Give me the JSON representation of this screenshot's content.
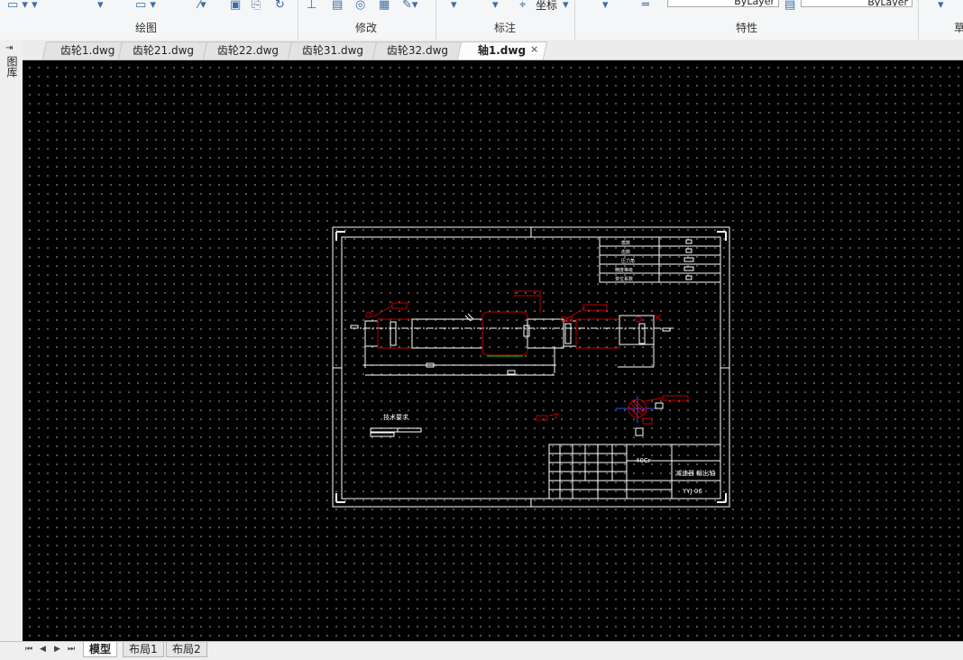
{
  "ribbon": {
    "groups": [
      {
        "label": "绘图"
      },
      {
        "label": "修改"
      },
      {
        "label": "标注"
      },
      {
        "label": "特性"
      },
      {
        "label": "草"
      }
    ],
    "coord_label": "坐标",
    "bylayer_1": "ByLayer",
    "bylayer_2": "ByLayer"
  },
  "sidebar": {
    "label": "图库"
  },
  "tabs": [
    {
      "label": "齿轮1.dwg",
      "active": false
    },
    {
      "label": "齿轮21.dwg",
      "active": false
    },
    {
      "label": "齿轮22.dwg",
      "active": false
    },
    {
      "label": "齿轮31.dwg",
      "active": false
    },
    {
      "label": "齿轮32.dwg",
      "active": false
    },
    {
      "label": "轴1.dwg",
      "active": true
    }
  ],
  "tab_close": "×",
  "drawing": {
    "tech_req_label": "技术要求",
    "material": "40Cr",
    "part_name": "减速器 輸出轴",
    "drawing_no": "YYJ-06",
    "table_rows": [
      "模数",
      "齿数",
      "压力角",
      "精度等级",
      "变位系数"
    ]
  },
  "layout_tabs": [
    {
      "label": "模型",
      "active": true
    },
    {
      "label": "布局1",
      "active": false
    },
    {
      "label": "布局2",
      "active": false
    }
  ],
  "nav_buttons": [
    "⏮",
    "◀",
    "▶",
    "⏭"
  ]
}
